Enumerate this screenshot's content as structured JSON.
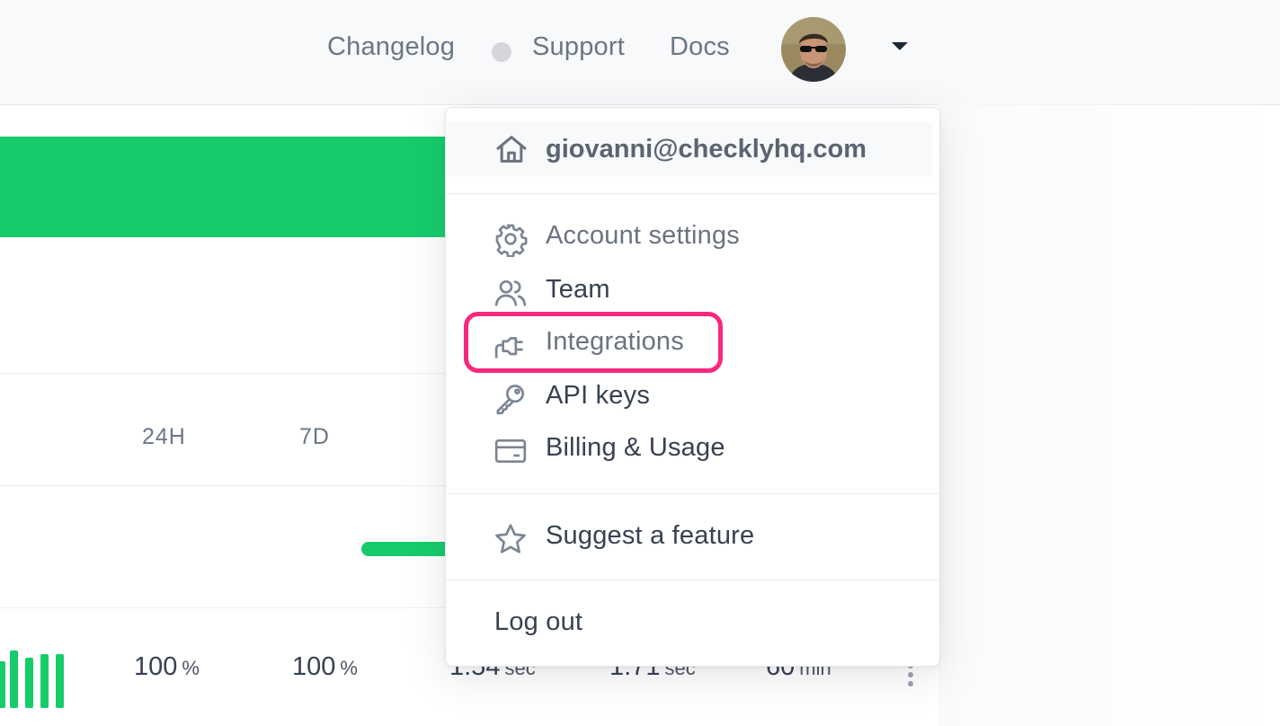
{
  "topbar": {
    "changelog_label": "Changelog",
    "support_label": "Support",
    "docs_label": "Docs"
  },
  "periods": [
    "24H",
    "7D"
  ],
  "stats": {
    "uptime_24h": "100",
    "uptime_7d": "100",
    "percent_unit": "%",
    "response_1": "1.54",
    "response_2": "1.71",
    "time_unit": "sec",
    "frequency": "60",
    "frequency_unit": "min"
  },
  "user_menu": {
    "email": "giovanni@checklyhq.com",
    "items": [
      {
        "label": "Account settings",
        "icon": "gear-icon"
      },
      {
        "label": "Team",
        "icon": "users-icon"
      },
      {
        "label": "Integrations",
        "icon": "plug-icon"
      },
      {
        "label": "API keys",
        "icon": "key-icon"
      },
      {
        "label": "Billing & Usage",
        "icon": "credit-card-icon"
      }
    ],
    "suggest_label": "Suggest a feature",
    "logout_label": "Log out"
  },
  "colors": {
    "brand_green": "#16cc6a",
    "highlight_pink": "#f7287f",
    "icon_gray": "#7b8594"
  }
}
